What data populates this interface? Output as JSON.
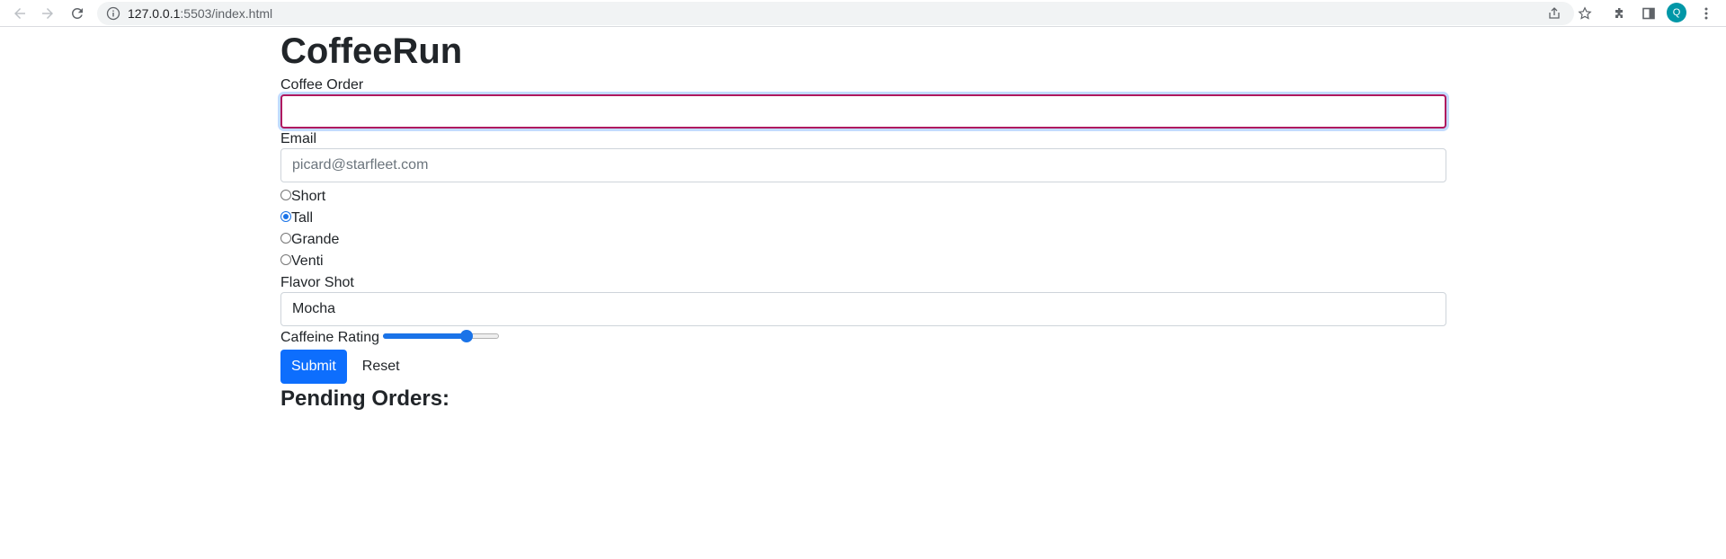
{
  "browser": {
    "url_host": "127.0.0.1",
    "url_path": ":5503/index.html",
    "profile_initial": "Q",
    "accent": "#1a73e8"
  },
  "page": {
    "title": "CoffeeRun",
    "coffee_order": {
      "label": "Coffee Order",
      "value": ""
    },
    "email": {
      "label": "Email",
      "placeholder": "picard@starfleet.com",
      "value": ""
    },
    "sizes": [
      {
        "label": "Short",
        "checked": false
      },
      {
        "label": "Tall",
        "checked": true
      },
      {
        "label": "Grande",
        "checked": false
      },
      {
        "label": "Venti",
        "checked": false
      }
    ],
    "flavor_shot": {
      "label": "Flavor Shot",
      "value": "Mocha"
    },
    "caffeine": {
      "label": "Caffeine Rating",
      "fraction": 0.75
    },
    "submit_label": "Submit",
    "reset_label": "Reset",
    "orders_heading": "Pending Orders:",
    "primary_color": "#0d6efd"
  }
}
